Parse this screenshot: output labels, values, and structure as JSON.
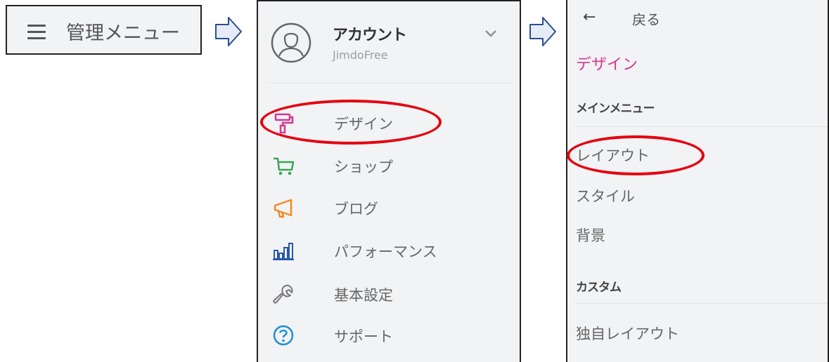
{
  "step1": {
    "menu_icon": "hamburger-icon",
    "label": "管理メニュー"
  },
  "arrow_icon": "right-outline-arrow-icon",
  "step2": {
    "account": {
      "name": "アカウント",
      "plan": "JimdoFree",
      "avatar_icon": "user-avatar-icon",
      "expand_icon": "chevron-down-icon"
    },
    "items": [
      {
        "label": "デザイン",
        "icon": "paint-roller-icon",
        "color": "#d4388f"
      },
      {
        "label": "ショップ",
        "icon": "shopping-cart-icon",
        "color": "#3aa655"
      },
      {
        "label": "ブログ",
        "icon": "megaphone-icon",
        "color": "#f08a24"
      },
      {
        "label": "パフォーマンス",
        "icon": "bar-chart-icon",
        "color": "#2a57a8"
      },
      {
        "label": "基本設定",
        "icon": "wrench-icon",
        "color": "#777777"
      },
      {
        "label": "サポート",
        "icon": "help-circle-icon",
        "color": "#1e8fd6"
      }
    ]
  },
  "step3": {
    "back_icon": "left-arrow-icon",
    "back_label": "戻る",
    "title": "デザイン",
    "main_menu_heading": "メインメニュー",
    "main_menu_items": [
      "レイアウト",
      "スタイル",
      "背景"
    ],
    "custom_heading": "カスタム",
    "custom_items": [
      "独自レイアウト"
    ]
  },
  "colors": {
    "highlight": "#e5000f",
    "panel_bg": "#f2f3f5",
    "design_accent": "#d4388f"
  }
}
